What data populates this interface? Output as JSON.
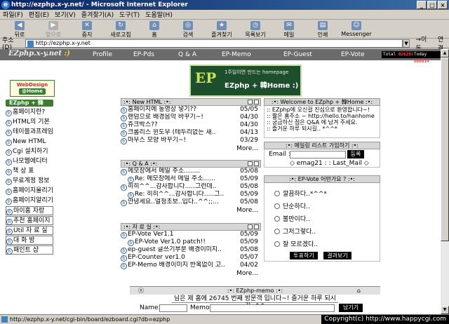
{
  "window": {
    "title": "http://ezphp.x-y.net/ - Microsoft Internet Explorer",
    "buttons": [
      "_",
      "□",
      "×"
    ]
  },
  "menu": [
    "파일(F)",
    "편집(E)",
    "보기(V)",
    "즐겨찾기(A)",
    "도구(T)",
    "도움말(H)"
  ],
  "toolbar": [
    {
      "label": "뒤로",
      "icon": "back-icon",
      "glyph": "◀",
      "enabled": true
    },
    {
      "label": "앞으로",
      "icon": "forward-icon",
      "glyph": "▶",
      "enabled": false
    },
    {
      "label": "중지",
      "icon": "stop-icon",
      "glyph": "✕",
      "enabled": true
    },
    {
      "label": "새로고침",
      "icon": "refresh-icon",
      "glyph": "↻",
      "enabled": true
    },
    {
      "label": "홈",
      "icon": "home-icon",
      "glyph": "⌂",
      "enabled": true
    },
    {
      "label": "검색",
      "icon": "search-icon",
      "glyph": "◎",
      "enabled": true
    },
    {
      "label": "즐겨찾기",
      "icon": "favorites-icon",
      "glyph": "★",
      "enabled": true
    },
    {
      "label": "목록보기",
      "icon": "history-icon",
      "glyph": "◷",
      "enabled": true
    },
    {
      "label": "메일",
      "icon": "mail-icon",
      "glyph": "✉",
      "enabled": true
    },
    {
      "label": "인쇄",
      "icon": "print-icon",
      "glyph": "▤",
      "enabled": true
    },
    {
      "label": "Messenger",
      "icon": "messenger-icon",
      "glyph": "☺",
      "enabled": true
    }
  ],
  "address": {
    "label": "주소(D)",
    "url": "http://ezphp.x-y.net",
    "go": "→이동",
    "links": "연결"
  },
  "site": {
    "logo": "EZphp.x-y.net",
    "logo_smile": ":)",
    "nav": [
      "Profile",
      "EP-Pds",
      "Q & A",
      "EP-Memo",
      "EP-Guest",
      "EP-Vote"
    ],
    "counter_total_label": "Total",
    "counter_total": "026201",
    "counter_today_label": "Today",
    "counter_today": "000014"
  },
  "sidebar": {
    "logo_top": "WebDesign",
    "logo_sub": "@Home",
    "home": "EZphp + 韓Home :)",
    "items": [
      "홈페이지란?",
      "HTML의 기본",
      "테이블과프레임",
      "New HTML",
      "Cgi 설치하기",
      "나모웹에디터",
      "책 상 표",
      "무료계정 정보",
      "홈페이지올리기",
      "홈페이지알리기",
      "마이홈 자랑",
      "추천 홈페이지",
      "Util 자 료 실",
      "대 화 방",
      "패인트 샵"
    ]
  },
  "banner": {
    "ep": "EP",
    "tagline": "1주일이면 만드는 homepage",
    "name": "EZphp + 韓Home :)"
  },
  "new_html": {
    "title": ":•: New HTML :•:",
    "rows": [
      {
        "t": "홈페이지에 동영상 넣기??",
        "d": "05/05"
      },
      {
        "t": "랜덤으로 배경음악 바꾸기~!",
        "d": "04/30"
      },
      {
        "t": "쥬크박스??",
        "d": "04/30"
      },
      {
        "t": "크롬리스 윈도우 (테두리없는 새..",
        "d": "04/13"
      },
      {
        "t": "마우스 모양 바꾸기~!",
        "d": "03/29"
      }
    ],
    "more": "More..."
  },
  "qna": {
    "title": ":•: Q & A :•:",
    "rows": [
      {
        "t": "메모장에서 메일 주소........",
        "d": "05/08",
        "reply": false
      },
      {
        "t": "Re: 메모장에서 메일 주소......",
        "d": "05/09",
        "reply": true
      },
      {
        "t": "히히^^...감사합니다.....그런데..",
        "d": "05/08",
        "reply": false
      },
      {
        "t": "Re: 히히^^...감사합니다.....그..",
        "d": "05/09",
        "reply": true
      },
      {
        "t": "안녕세요..얼청초보..입다..^^;;...",
        "d": "05/08",
        "reply": false
      }
    ],
    "more": "More..."
  },
  "pds": {
    "title": ":•: 자 료 실 :•:",
    "rows": [
      {
        "t": "EP-Vote Ver1.1",
        "d": "05/09",
        "reply": false
      },
      {
        "t": "EP-Vote Ver1.0 patch!!",
        "d": "05/09",
        "reply": true
      },
      {
        "t": "ep-guest 글쓰기부분 배경이미지..",
        "d": "05/08",
        "reply": false
      },
      {
        "t": "EP-Counter ver1.0",
        "d": "05/07",
        "reply": false
      },
      {
        "t": "EP-Memo 배경이미지 반복없이 고..",
        "d": "04/02",
        "reply": false
      }
    ],
    "more": "More..."
  },
  "welcome": {
    "title": ":•: Welcome to EZphp + 韓Home :•:",
    "lines": [
      ":: EZphp에 오신걸 진심으로 환영합니다~!",
      ":: 짧은 홈주소 ~ http://hello.to/hanhome",
      ":: 궁금하신 점은 Q&A 에 남겨 주세요.",
      ":: 즐거운 하루 되시길.. *^^*"
    ]
  },
  "mailing": {
    "title": ":•: 메일링 리스트 가입하기 :•:",
    "email_label": "Email :",
    "register": "등록",
    "links": "◇ emag21 : : Last_Mail ◇"
  },
  "vote": {
    "title": ":•: EP-Vote 어떤가요 ? :•:",
    "options": [
      "깔끔하다..*^^*",
      "단순하다..",
      "불만이다..",
      "그저그렇다..",
      "잘 모르겠다.."
    ],
    "vote_btn": "투표하기",
    "result_btn": "결과보기"
  },
  "memo": {
    "title": ":•: EZphp-memo :•:",
    "left_icon": "ⓔ",
    "right_icon": "⌂",
    "marquee": "님은 제 홈에 26745 번째 방문객 입니다~! 즐거운 하루 되시길..^^",
    "name_label": "Name:",
    "memo_label": "Memo:",
    "submit": "남기기"
  },
  "status": {
    "text": "http://ezphp.x-y.net/cgi-bin/board/ezboard.cgi?db=ezphp",
    "watermark": "Copyright(c) http://www.happycgi.com"
  }
}
